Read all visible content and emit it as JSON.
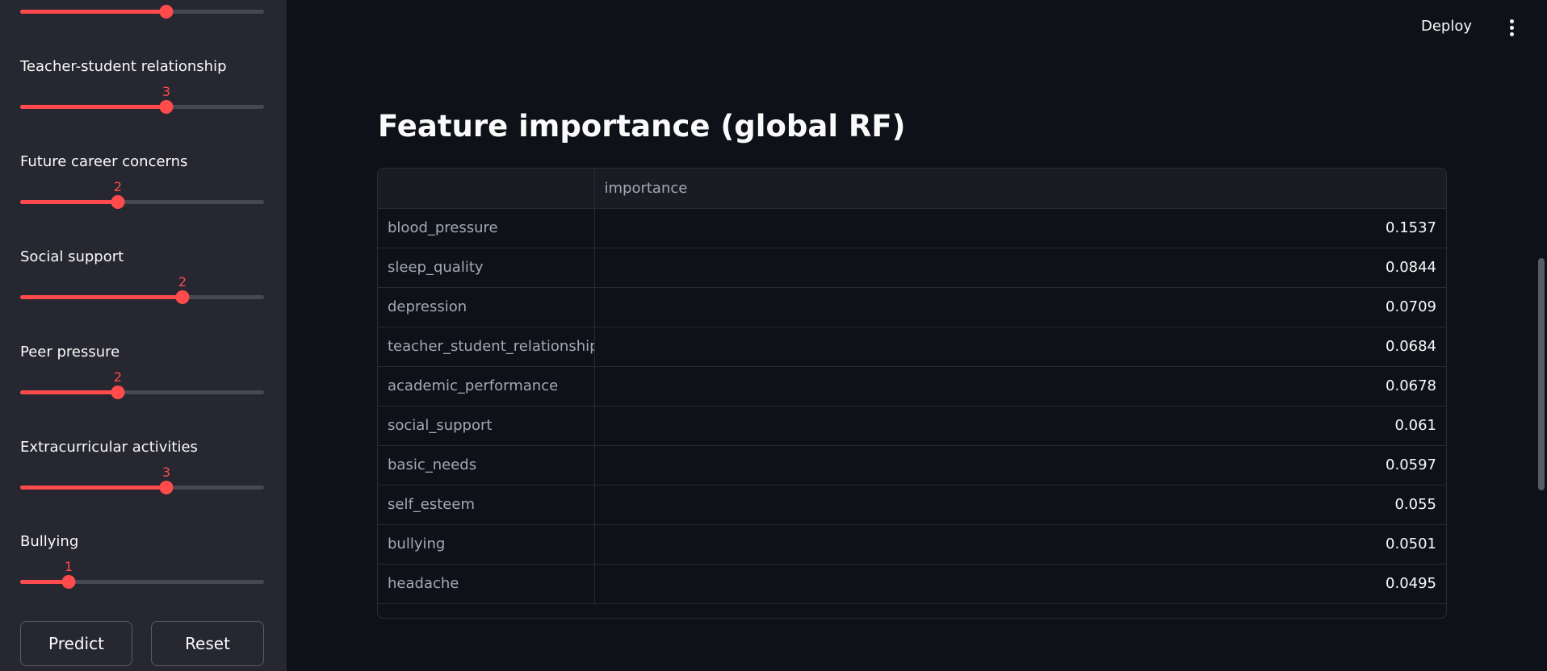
{
  "sidebar": {
    "sliders": [
      {
        "label": "",
        "value": 3,
        "max": 5,
        "value_visible": false
      },
      {
        "label": "Teacher-student relationship",
        "value": 3,
        "max": 5,
        "value_visible": true
      },
      {
        "label": "Future career concerns",
        "value": 2,
        "max": 5,
        "value_visible": true
      },
      {
        "label": "Social support",
        "value": 2,
        "max": 3,
        "value_visible": true
      },
      {
        "label": "Peer pressure",
        "value": 2,
        "max": 5,
        "value_visible": true
      },
      {
        "label": "Extracurricular activities",
        "value": 3,
        "max": 5,
        "value_visible": true
      },
      {
        "label": "Bullying",
        "value": 1,
        "max": 5,
        "value_visible": true
      }
    ],
    "predict_label": "Predict",
    "reset_label": "Reset"
  },
  "header": {
    "deploy_label": "Deploy",
    "menu_icon": "vertical-ellipsis-icon"
  },
  "main": {
    "title": "Feature importance (global RF)",
    "table": {
      "columns": [
        "",
        "importance"
      ],
      "rows": [
        {
          "feature": "blood_pressure",
          "importance": "0.1537"
        },
        {
          "feature": "sleep_quality",
          "importance": "0.0844"
        },
        {
          "feature": "depression",
          "importance": "0.0709"
        },
        {
          "feature": "teacher_student_relationship",
          "importance": "0.0684"
        },
        {
          "feature": "academic_performance",
          "importance": "0.0678"
        },
        {
          "feature": "social_support",
          "importance": "0.061"
        },
        {
          "feature": "basic_needs",
          "importance": "0.0597"
        },
        {
          "feature": "self_esteem",
          "importance": "0.055"
        },
        {
          "feature": "bullying",
          "importance": "0.0501"
        },
        {
          "feature": "headache",
          "importance": "0.0495"
        }
      ]
    }
  },
  "colors": {
    "accent": "#ff4b4b",
    "background": "#0e1117",
    "sidebar": "#262730"
  }
}
